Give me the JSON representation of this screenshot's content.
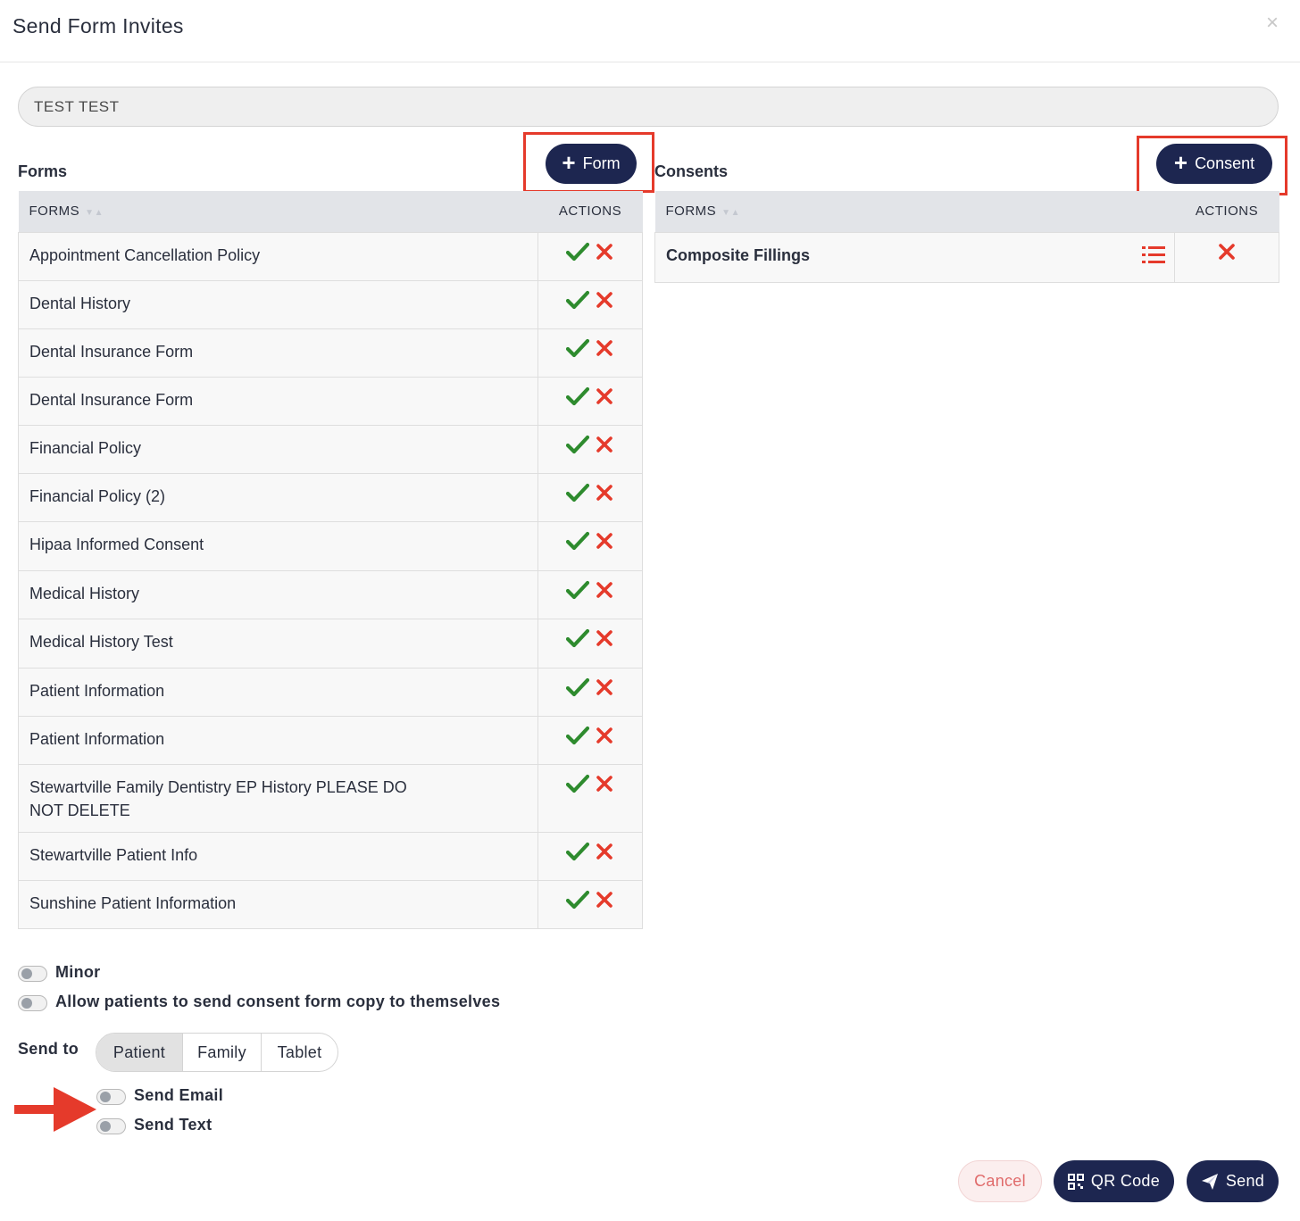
{
  "modal": {
    "title": "Send Form Invites",
    "close_glyph": "×"
  },
  "patient": {
    "value": "TEST TEST"
  },
  "forms_section": {
    "label": "Forms",
    "add_button": "Form",
    "col_forms": "FORMS",
    "col_actions": "ACTIONS",
    "rows": [
      "Appointment Cancellation Policy",
      "Dental History",
      "Dental Insurance Form",
      "Dental Insurance Form",
      "Financial Policy",
      "Financial Policy (2)",
      "Hipaa Informed Consent",
      "Medical History",
      "Medical History Test",
      "Patient Information",
      "Patient Information",
      "Stewartville Family Dentistry EP History PLEASE DO NOT DELETE",
      "Stewartville Patient Info",
      "Sunshine Patient Information"
    ]
  },
  "consents_section": {
    "label": "Consents",
    "add_button": "Consent",
    "col_forms": "FORMS",
    "col_actions": "ACTIONS",
    "rows": [
      "Composite Fillings"
    ]
  },
  "options": {
    "minor": "Minor",
    "allow_copy": "Allow patients to send consent form copy to themselves"
  },
  "send_to": {
    "label": "Send to",
    "tabs": [
      "Patient",
      "Family",
      "Tablet"
    ],
    "selected": "Patient",
    "send_email": "Send Email",
    "send_text": "Send Text"
  },
  "footer": {
    "cancel": "Cancel",
    "qr_code": "QR Code",
    "send": "Send"
  },
  "colors": {
    "navy": "#1d2650",
    "highlight": "#e53a2b",
    "check": "#2e8b2e",
    "x": "#e53a2b"
  },
  "icons": {
    "check": "check-icon",
    "remove": "x-icon",
    "list": "list-icon",
    "qr": "qr-code-icon",
    "send": "paper-plane-icon",
    "arrow": "arrow-right-icon"
  }
}
